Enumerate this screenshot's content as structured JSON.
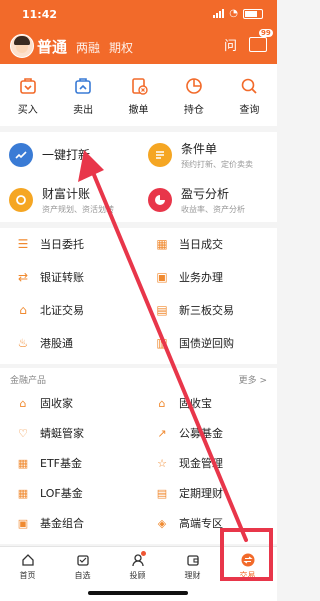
{
  "status": {
    "time": "11:42"
  },
  "header": {
    "mode_active": "普通",
    "mode_2": "两融",
    "mode_3": "期权",
    "question_icon_text": "问",
    "message_badge": "99"
  },
  "quick_actions": [
    {
      "label": "买入",
      "icon": "buy-icon"
    },
    {
      "label": "卖出",
      "icon": "sell-icon"
    },
    {
      "label": "撤单",
      "icon": "cancel-order-icon"
    },
    {
      "label": "持仓",
      "icon": "position-icon"
    },
    {
      "label": "查询",
      "icon": "search-icon"
    }
  ],
  "features": [
    {
      "title": "一键打新",
      "subtitle": "",
      "icon": "ipo-icon",
      "color": "#3a7bd5"
    },
    {
      "title": "条件单",
      "subtitle": "预约打新、定价卖卖",
      "icon": "condition-order-icon",
      "color": "#f5a623"
    },
    {
      "title": "财富计账",
      "subtitle": "资产规划、资活划转",
      "icon": "wealth-icon",
      "color": "#f5a623"
    },
    {
      "title": "盈亏分析",
      "subtitle": "收益率、资产分析",
      "icon": "profit-icon",
      "color": "#e8364a"
    }
  ],
  "grid_items": [
    {
      "label": "当日委托",
      "icon": "entrust-icon"
    },
    {
      "label": "当日成交",
      "icon": "deal-icon"
    },
    {
      "label": "银证转账",
      "icon": "transfer-icon"
    },
    {
      "label": "业务办理",
      "icon": "business-icon"
    },
    {
      "label": "北证交易",
      "icon": "bse-icon"
    },
    {
      "label": "新三板交易",
      "icon": "neeq-icon"
    },
    {
      "label": "港股通",
      "icon": "hk-connect-icon"
    },
    {
      "label": "国债逆回购",
      "icon": "repo-icon"
    }
  ],
  "finance": {
    "header": "金融产品",
    "more": "更多 >",
    "items": [
      {
        "label": "固收家",
        "icon": "fixed-income-icon"
      },
      {
        "label": "固收宝",
        "icon": "fixed-income-bao-icon"
      },
      {
        "label": "蜻蜓管家",
        "icon": "dragonfly-icon"
      },
      {
        "label": "公募基金",
        "icon": "public-fund-icon"
      },
      {
        "label": "ETF基金",
        "icon": "etf-icon"
      },
      {
        "label": "现金管理",
        "icon": "cash-icon"
      },
      {
        "label": "LOF基金",
        "icon": "lof-icon"
      },
      {
        "label": "定期理财",
        "icon": "regular-finance-icon"
      },
      {
        "label": "基金组合",
        "icon": "fund-portfolio-icon"
      },
      {
        "label": "高端专区",
        "icon": "premium-icon"
      }
    ]
  },
  "tabbar": [
    {
      "label": "首页",
      "icon": "home-icon"
    },
    {
      "label": "自选",
      "icon": "watchlist-icon"
    },
    {
      "label": "投顾",
      "icon": "advisor-icon"
    },
    {
      "label": "理财",
      "icon": "wealth-tab-icon"
    },
    {
      "label": "交易",
      "icon": "trade-icon"
    }
  ],
  "colors": {
    "brand": "#f26a2a",
    "annotation": "#e8364a"
  }
}
